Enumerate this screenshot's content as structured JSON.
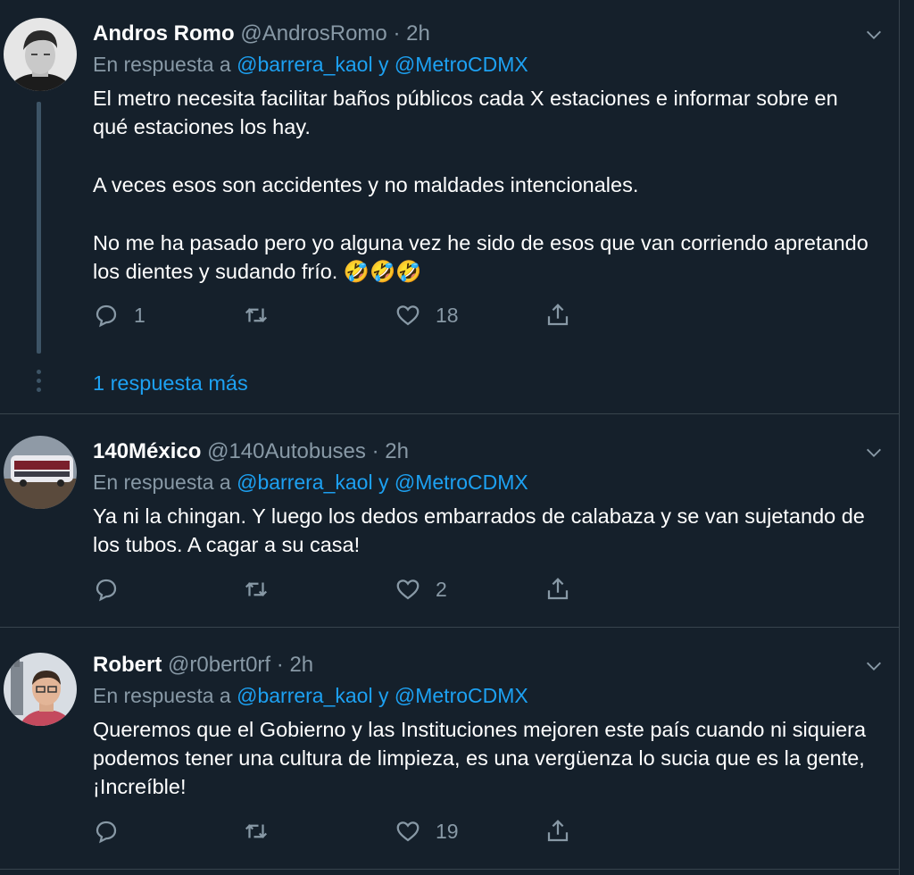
{
  "tweets": [
    {
      "name": "Andros Romo",
      "handle": "@AndrosRomo",
      "sep": "·",
      "time": "2h",
      "reply_prefix": "En respuesta a",
      "mention1": "@barrera_kaol",
      "conj": "y",
      "mention2": "@MetroCDMX",
      "paragraphs": [
        "El metro necesita facilitar baños públicos cada X estaciones e informar sobre en qué estaciones los hay.",
        "A veces esos son accidentes y no maldades intencionales.",
        "No me ha pasado pero yo alguna  vez he sido de esos que van corriendo apretando los dientes y sudando frío. 🤣🤣🤣"
      ],
      "replies": "1",
      "retweets": "",
      "likes": "18",
      "more_replies": "1 respuesta más"
    },
    {
      "name": "140México",
      "handle": "@140Autobuses",
      "sep": "·",
      "time": "2h",
      "reply_prefix": "En respuesta a",
      "mention1": "@barrera_kaol",
      "conj": "y",
      "mention2": "@MetroCDMX",
      "paragraphs": [
        "Ya ni la chingan. Y luego los dedos embarrados de calabaza y se van sujetando de los tubos. A cagar a su casa!"
      ],
      "replies": "",
      "retweets": "",
      "likes": "2"
    },
    {
      "name": "Robert",
      "handle": "@r0bert0rf",
      "sep": "·",
      "time": "2h",
      "reply_prefix": "En respuesta a",
      "mention1": "@barrera_kaol",
      "conj": "y",
      "mention2": "@MetroCDMX",
      "paragraphs": [
        "Queremos que el Gobierno y las Instituciones mejoren este país cuando ni siquiera podemos tener una cultura de limpieza, es una vergüenza lo sucia que es la gente, ¡Increíble!"
      ],
      "replies": "",
      "retweets": "",
      "likes": "19"
    }
  ],
  "colors": {
    "background": "#15202b",
    "secondary_text": "#8899a6",
    "link": "#1da1f2",
    "border": "#38444d"
  }
}
